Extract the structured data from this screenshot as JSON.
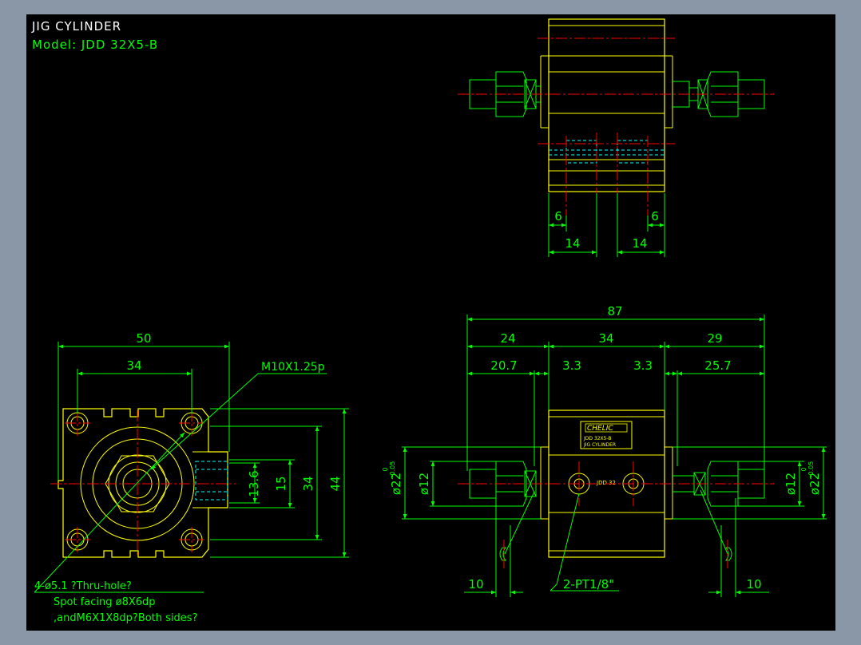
{
  "title": {
    "name": "JIG CYLINDER",
    "model": "Model: JDD 32X5-B"
  },
  "colors": {
    "background": "#000000",
    "frame": "#8a97a6",
    "body": "#ffff00",
    "dimension": "#00ff00",
    "centerline": "#ff0000",
    "hidden": "#00ffff",
    "title": "#ffffff"
  },
  "top_view": {
    "dims": {
      "left_6": "6",
      "right_6": "6",
      "left_14": "14",
      "right_14": "14"
    }
  },
  "front_view": {
    "dims": {
      "overall": "87",
      "seg_24": "24",
      "seg_34": "34",
      "seg_29": "29",
      "d207": "20.7",
      "d33a": "3.3",
      "d33b": "3.3",
      "d257": "25.7",
      "lead_left": "10",
      "lead_right": "10"
    },
    "diameters": {
      "left_12": "ø12",
      "right_12": "ø12",
      "left_22": "ø22",
      "right_22": "ø22",
      "tol_upper": "0",
      "tol_lower": "-0.05"
    },
    "port_label": "2-PT1/8\"",
    "nameplate": {
      "brand": "CHELIC",
      "line1": "JDD 32X5-B",
      "line2": "JIG CYLINDER",
      "small": "JDD 32"
    }
  },
  "side_view": {
    "dims": {
      "width_50": "50",
      "bolt_34": "34",
      "h13_6": "13.6",
      "h15": "15",
      "h34": "34",
      "h44": "44"
    },
    "thread_label": "M10X1.25p",
    "note": {
      "line1": "4-ø5.1 ?Thru-hole?",
      "line2": "Spot facing ø8X6dp",
      "line3": ",andM6X1X8dp?Both sides?"
    }
  }
}
